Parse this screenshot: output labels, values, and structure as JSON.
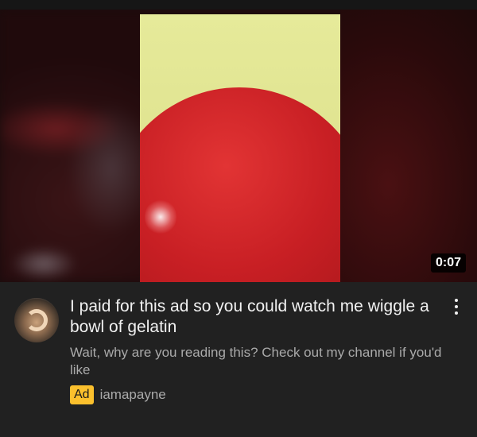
{
  "video": {
    "duration": "0:07"
  },
  "ad": {
    "title": "I paid for this ad so you could watch me wiggle a bowl of gelatin",
    "description": "Wait, why are you reading this? Check out my channel if you'd like",
    "badge": "Ad",
    "channel": "iamapayne"
  },
  "icons": {
    "menu": "more-vert-icon",
    "avatar": "channel-avatar"
  },
  "colors": {
    "background": "#212121",
    "title": "#f1f1f1",
    "secondary_text": "#aaaaaa",
    "ad_badge": "#fbc02d"
  }
}
